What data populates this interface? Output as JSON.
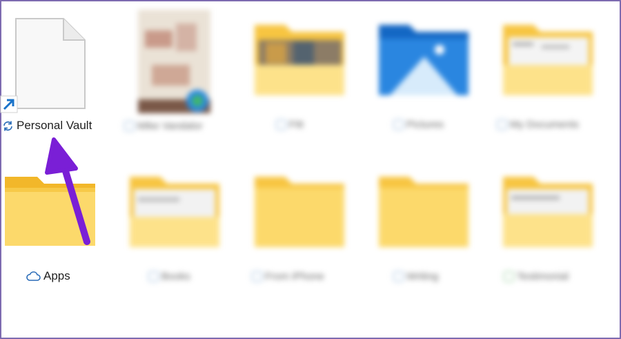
{
  "explorer": {
    "items": [
      {
        "label": "Personal Vault",
        "status_icon": "sync-icon",
        "icon": "shortcut-file-icon",
        "blurred": false
      },
      {
        "label": "Mike Vandalor",
        "status_icon": "cloud-status-icon",
        "icon": "photo-thumbnail-icon",
        "blurred": true
      },
      {
        "label": "Fitt",
        "status_icon": "cloud-status-icon",
        "icon": "folder-icon",
        "blurred": true
      },
      {
        "label": "Pictures",
        "status_icon": "cloud-status-icon",
        "icon": "pictures-folder-icon",
        "blurred": true
      },
      {
        "label": "My Documents",
        "status_icon": "cloud-status-icon",
        "icon": "folder-icon",
        "blurred": true
      },
      {
        "label": "Apps",
        "status_icon": "cloud-icon",
        "icon": "folder-icon",
        "blurred": false
      },
      {
        "label": "Books",
        "status_icon": "cloud-status-icon",
        "icon": "folder-icon",
        "blurred": true
      },
      {
        "label": "From iPhone",
        "status_icon": "cloud-status-icon",
        "icon": "folder-icon",
        "blurred": true
      },
      {
        "label": "Writing",
        "status_icon": "cloud-status-icon",
        "icon": "folder-icon",
        "blurred": true
      },
      {
        "label": "Testimonial",
        "status_icon": "synced-status-icon",
        "icon": "folder-icon",
        "blurred": true
      }
    ]
  },
  "colors": {
    "annotation_arrow": "#7a1fd6",
    "folder_back": "#f7c541",
    "folder_front": "#fde28a",
    "pictures_folder": "#1f7ad8"
  }
}
